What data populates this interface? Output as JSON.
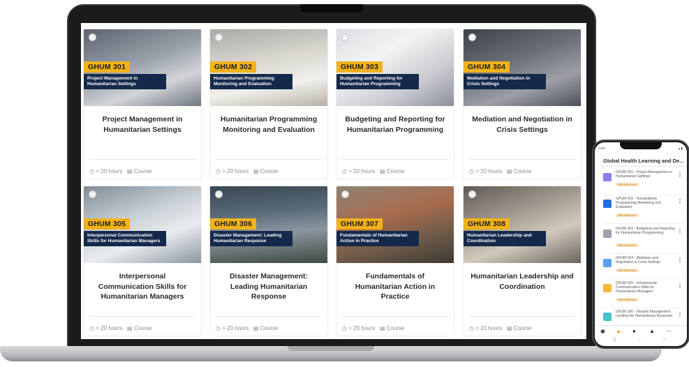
{
  "courses": [
    {
      "code": "GHUM 301",
      "banner": "Project Management in Humanitarian Settings",
      "title": "Project Management in Humanitarian Settings",
      "duration": "> 20 hours",
      "type": "Course"
    },
    {
      "code": "GHUM 302",
      "banner": "Humanitarian Programming Monitoring and Evaluation",
      "title": "Humanitarian Programming Monitoring and Evaluation",
      "duration": "> 20 hours",
      "type": "Course"
    },
    {
      "code": "GHUM 303",
      "banner": "Budgeting and Reporting for Humanitarian Programming",
      "title": "Budgeting and Reporting for Humanitarian Programming",
      "duration": "> 20 hours",
      "type": "Course"
    },
    {
      "code": "GHUM 304",
      "banner": "Mediation and Negotiation in Crisis Settings",
      "title": "Mediation and Negotiation in Crisis Settings",
      "duration": "> 20 hours",
      "type": "Course"
    },
    {
      "code": "GHUM 305",
      "banner": "Interpersonal Communication Skills for Humanitarian Managers",
      "title": "Interpersonal Communication Skills for Humanitarian Managers",
      "duration": "> 20 hours",
      "type": "Course"
    },
    {
      "code": "GHUM 306",
      "banner": "Disaster Management: Leading Humanitarian Response",
      "title": "Disaster Management: Leading Humanitarian Response",
      "duration": "> 20 hours",
      "type": "Course"
    },
    {
      "code": "GHUM 307",
      "banner": "Fundamentals of Humanitarian Action in Practice",
      "title": "Fundamentals of Humanitarian Action in Practice",
      "duration": "> 20 hours",
      "type": "Course"
    },
    {
      "code": "GHUM 308",
      "banner": "Humanitarian Leadership and Coordination",
      "title": "Humanitarian Leadership and Coordination",
      "duration": "> 20 hours",
      "type": "Course"
    }
  ],
  "icons": {
    "duration": "clock-icon",
    "type": "book-icon",
    "menu": "more-vertical-icon"
  },
  "phone": {
    "status_time": "3:06",
    "app_title": "Global Health Learning and De...",
    "badge": "",
    "items": [
      {
        "text": "GHUM 301 - Project Management in Humanitarian Settings",
        "tag": "Miscellaneous",
        "color": "#8f7cf2"
      },
      {
        "text": "GHUM 302 - Humanitarian Programming Monitoring and Evaluation",
        "tag": "Miscellaneous",
        "color": "#1f6fe0"
      },
      {
        "text": "GHUM 303 - Budgeting and Reporting for Humanitarian Programming",
        "tag": "Miscellaneous",
        "color": "#9aa3ad"
      },
      {
        "text": "GHUM 304 - Mediation and Negotiation in Crisis Settings",
        "tag": "Miscellaneous",
        "color": "#5aa0f2"
      },
      {
        "text": "GHUM 305 - Interpersonal Communication Skills for Humanitarian Managers",
        "tag": "Miscellaneous",
        "color": "#f5b83a"
      },
      {
        "text": "GHUM 306 - Disaster Management: Leading the Humanitarian Response",
        "tag": "",
        "color": "#45c3cc"
      }
    ],
    "menu_glyph": "⋮"
  },
  "colors": {
    "code_tag": "#f2b21b",
    "banner": "#152a4b",
    "tag_bg": "#fde8c8",
    "tag_text": "#c77a1b",
    "nav_active": "#f39c12"
  }
}
